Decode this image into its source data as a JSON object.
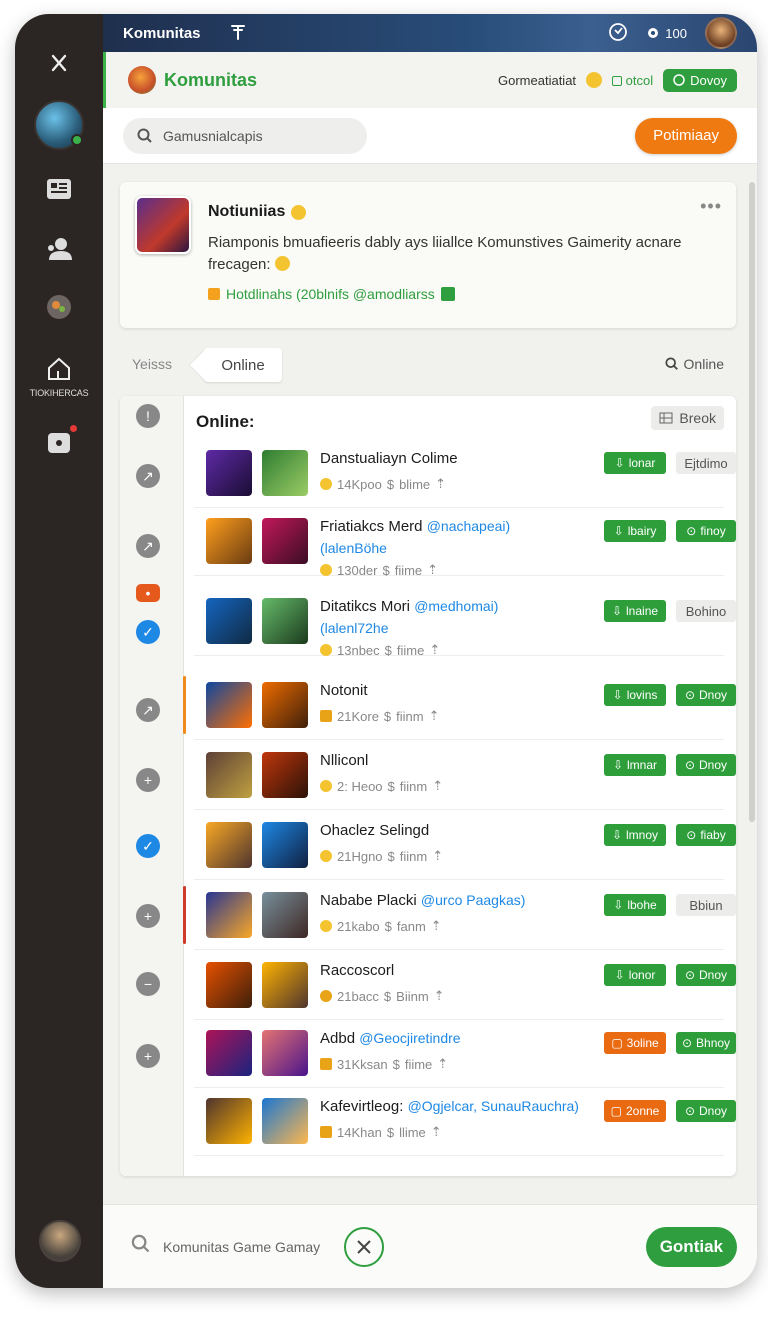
{
  "topbar": {
    "title": "Komunitas",
    "pin_icon": "pin-icon",
    "counter": "100"
  },
  "header": {
    "name": "Komunitas",
    "label": "Gormeatiatiat",
    "green_link": "otcol",
    "button": "Dovoy"
  },
  "search": {
    "placeholder": "Gamusnialcapis"
  },
  "action_button": "Potimiaay",
  "rail": {
    "label": "TIOKIHERCAS"
  },
  "post": {
    "title": "Notiuniias",
    "body": "Riamponis bmuafieeris dably ays liiallce Komunstives Gaimerity acnare frecagen:",
    "tags": "Hotdlinahs (20blnifs @amodliarss"
  },
  "tabs": {
    "inactive": "Yeisss",
    "active": "Online",
    "right": "Online"
  },
  "list": {
    "header": "Online:",
    "break_button": "Breok"
  },
  "rows": [
    {
      "title": "Danstualiayn Colime",
      "handle": "",
      "handle2": "",
      "meta": "14Kpoo",
      "meta2": "blime",
      "btn1": "lonar",
      "btn2": "Ejtdimo",
      "btn1_color": "green",
      "btn2_style": "light"
    },
    {
      "title": "Friatiakcs Merd",
      "handle": "@nachapeai)",
      "handle2": "(lalenBöhe",
      "meta": "130der",
      "meta2": "fiime",
      "btn1": "lbairy",
      "btn2": "finoy",
      "btn1_color": "green",
      "btn2_style": "green"
    },
    {
      "title": "Ditatikcs Mori",
      "handle": "@medhomai)",
      "handle2": "(lalenl72he",
      "meta": "13nbec",
      "meta2": "fiime",
      "btn1": "lnaine",
      "btn2": "Bohino",
      "btn1_color": "green",
      "btn2_style": "light"
    },
    {
      "title": "Notonit",
      "handle": "",
      "handle2": "",
      "meta": "21Kore",
      "meta2": "fiinm",
      "btn1": "lovins",
      "btn2": "Dnoy",
      "btn1_color": "green",
      "btn2_style": "green"
    },
    {
      "title": "Nlliconl",
      "handle": "",
      "handle2": "",
      "meta": "2: Heoo",
      "meta2": "fiinm",
      "btn1": "lmnar",
      "btn2": "Dnoy",
      "btn1_color": "green",
      "btn2_style": "green"
    },
    {
      "title": "Ohaclez Selingd",
      "handle": "",
      "handle2": "",
      "meta": "21Hgno",
      "meta2": "fiinm",
      "btn1": "lmnoy",
      "btn2": "fiaby",
      "btn1_color": "green",
      "btn2_style": "green"
    },
    {
      "title": "Nababe Placki",
      "handle": "@urco Paagkas)",
      "handle2": "",
      "meta": "21kabo",
      "meta2": "fanm",
      "btn1": "lbohe",
      "btn2": "Bbiun",
      "btn1_color": "green",
      "btn2_style": "light"
    },
    {
      "title": "Raccoscorl",
      "handle": "",
      "handle2": "",
      "meta": "21bacc",
      "meta2": "Biinm",
      "btn1": "lonor",
      "btn2": "Dnoy",
      "btn1_color": "green",
      "btn2_style": "green"
    },
    {
      "title": "Adbd",
      "handle": "@Geocjiretindre",
      "handle2": "",
      "meta": "31Kksan",
      "meta2": "fiime",
      "btn1": "3oline",
      "btn2": "Bhnoy",
      "btn1_color": "orange",
      "btn2_style": "green"
    },
    {
      "title": "Kafevirtleog:",
      "handle": "@Ogjelcar, SunauRauchra)",
      "handle2": "",
      "meta": "14Khan",
      "meta2": "llime",
      "btn1": "2onne",
      "btn2": "Dnoy",
      "btn1_color": "orange",
      "btn2_style": "green"
    }
  ],
  "bottom": {
    "text": "Komunitas Game Gamay",
    "contact": "Gontiak"
  },
  "colors": {
    "brand_green": "#2f9e3e",
    "accent_orange": "#f07a12",
    "link_blue": "#1e88e5",
    "rail": "#2b2523"
  }
}
